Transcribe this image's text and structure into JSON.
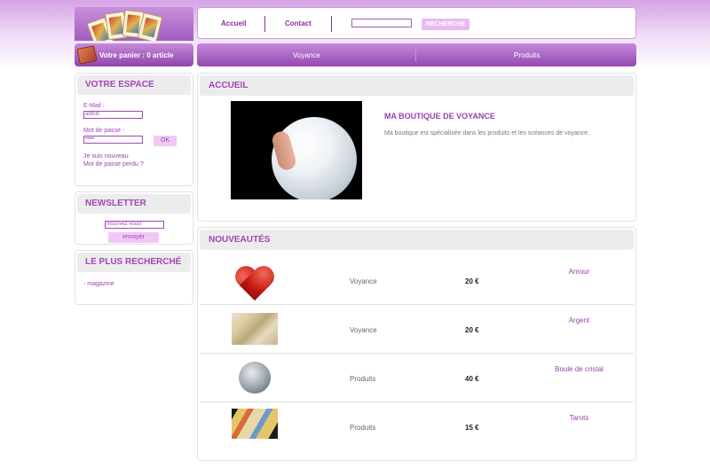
{
  "header": {
    "cart_text": "Votre panier : 0 article",
    "nav": [
      {
        "label": "Accueil"
      },
      {
        "label": "Contact"
      }
    ],
    "search_value": "",
    "search_button": "RECHERCHE"
  },
  "menu": [
    {
      "label": "Voyance"
    },
    {
      "label": "Produits"
    }
  ],
  "espace": {
    "title": "VOTRE ESPACE",
    "email_label": "E-Mail :",
    "email_value": "admin",
    "password_label": "Mot de passe :",
    "password_value": "•••••",
    "ok_button": "OK",
    "register_link": "Je suis nouveau",
    "lost_password_link": "Mot de passe perdu ?"
  },
  "newsletter": {
    "title": "NEWSLETTER",
    "input_value": "Inscrivez vous!",
    "button": "envoyer"
  },
  "popular": {
    "title": "LE PLUS RECHERCHÉ",
    "items": [
      {
        "label": "- magazine"
      }
    ]
  },
  "home": {
    "title": "ACCUEIL",
    "shop_title": "MA BOUTIQUE DE VOYANCE",
    "shop_description": "Ma boutique est spécialisée dans les produits et les scéances de voyance."
  },
  "new_products": {
    "title": "NOUVEAUTÉS",
    "items": [
      {
        "category": "Voyance",
        "price": "20 €",
        "name": "Amour",
        "thumb": "heart-image"
      },
      {
        "category": "Voyance",
        "price": "20 €",
        "name": "Argent",
        "thumb": "tarot-cards-image"
      },
      {
        "category": "Produits",
        "price": "40 €",
        "name": "Boule de cristal",
        "thumb": "crystal-ball-image"
      },
      {
        "category": "Produits",
        "price": "15 €",
        "name": "Tarots",
        "thumb": "tarot-deck-image"
      }
    ]
  },
  "colors": {
    "accent": "#a146b4",
    "menu": "#9548b1",
    "panel_header": "#ececec"
  }
}
